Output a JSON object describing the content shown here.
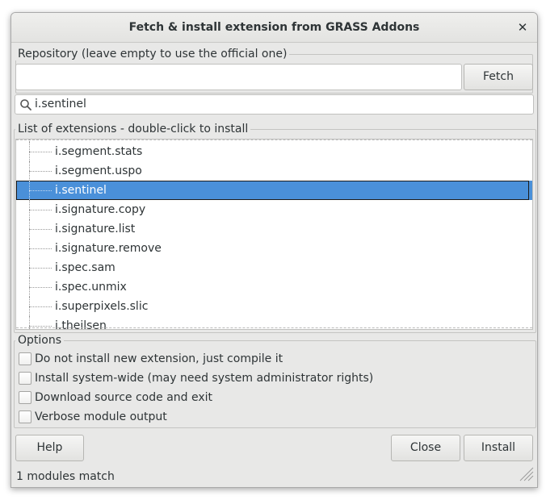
{
  "window": {
    "title": "Fetch & install extension from GRASS Addons",
    "close_glyph": "✕"
  },
  "repository": {
    "group_label": "Repository (leave empty to use the official one)",
    "url_value": "",
    "fetch_label": "Fetch"
  },
  "search": {
    "value": "i.sentinel",
    "icon": "search-icon"
  },
  "extensions": {
    "group_label": "List of extensions - double-click to install",
    "items": [
      {
        "label": "i.segment.stats",
        "selected": false
      },
      {
        "label": "i.segment.uspo",
        "selected": false
      },
      {
        "label": "i.sentinel",
        "selected": true
      },
      {
        "label": "i.signature.copy",
        "selected": false
      },
      {
        "label": "i.signature.list",
        "selected": false
      },
      {
        "label": "i.signature.remove",
        "selected": false
      },
      {
        "label": "i.spec.sam",
        "selected": false
      },
      {
        "label": "i.spec.unmix",
        "selected": false
      },
      {
        "label": "i.superpixels.slic",
        "selected": false
      },
      {
        "label": "i.theilsen",
        "selected": false
      }
    ]
  },
  "options": {
    "group_label": "Options",
    "checkboxes": [
      {
        "label": "Do not install new extension, just compile it",
        "checked": false
      },
      {
        "label": "Install system-wide (may need system administrator rights)",
        "checked": false
      },
      {
        "label": "Download source code and exit",
        "checked": false
      },
      {
        "label": "Verbose module output",
        "checked": false
      }
    ]
  },
  "buttons": {
    "help": "Help",
    "close": "Close",
    "install": "Install"
  },
  "status": {
    "text": "1 modules match"
  },
  "colors": {
    "selection": "#4a90d9",
    "window_bg": "#e8e8e7"
  }
}
